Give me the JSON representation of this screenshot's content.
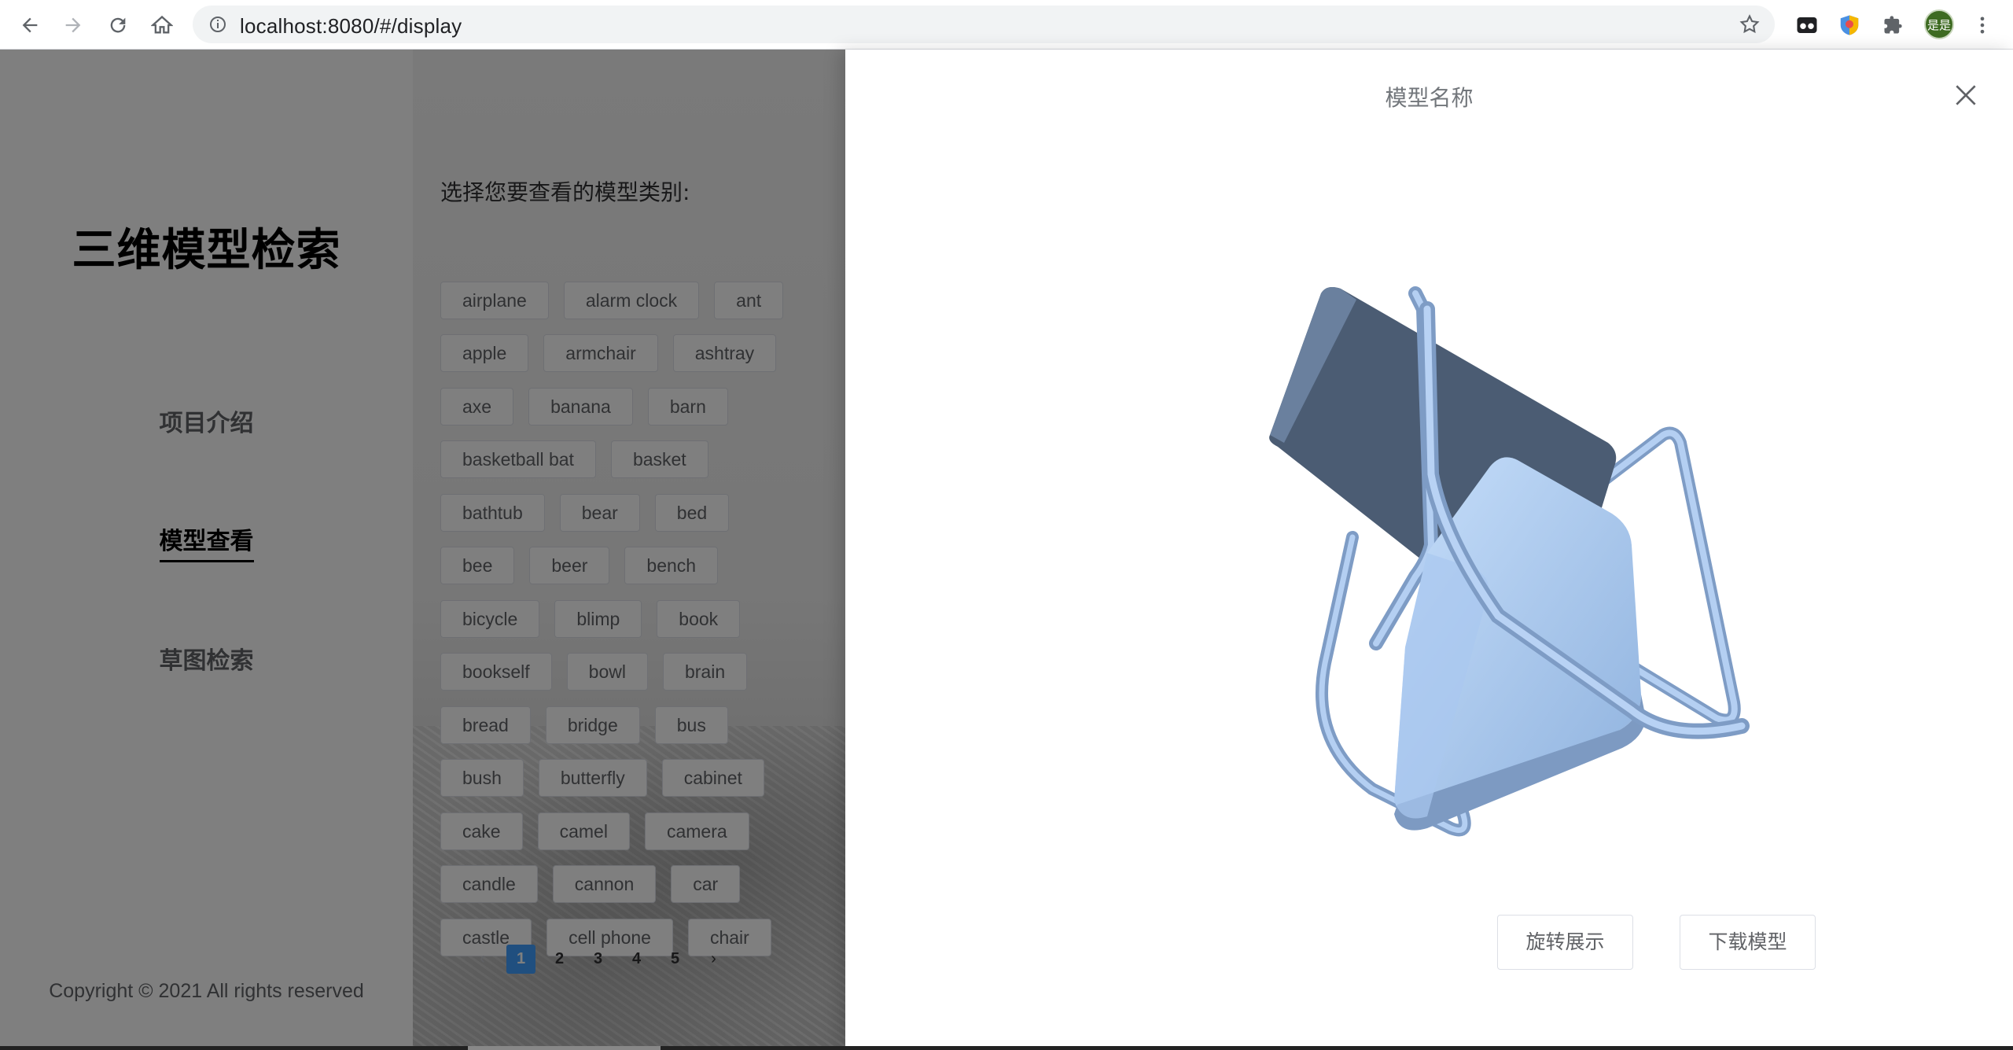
{
  "browser": {
    "url": "localhost:8080/#/display",
    "profile_initials": "是是"
  },
  "sidebar": {
    "brand": "三维模型检索",
    "menu": [
      {
        "label": "项目介绍",
        "active": false
      },
      {
        "label": "模型查看",
        "active": true
      },
      {
        "label": "草图检索",
        "active": false
      }
    ],
    "copyright": "Copyright © 2021 All rights reserved"
  },
  "main": {
    "select_title": "选择您要查看的模型类别:",
    "tag_rows": [
      [
        "airplane",
        "alarm clock",
        "ant"
      ],
      [
        "apple",
        "armchair",
        "ashtray"
      ],
      [
        "axe",
        "banana",
        "barn"
      ],
      [
        "basketball bat",
        "basket"
      ],
      [
        "bathtub",
        "bear",
        "bed"
      ],
      [
        "bee",
        "beer",
        "bench"
      ],
      [
        "bicycle",
        "blimp",
        "book"
      ],
      [
        "bookself",
        "bowl",
        "brain"
      ],
      [
        "bread",
        "bridge",
        "bus"
      ],
      [
        "bush",
        "butterfly",
        "cabinet"
      ],
      [
        "cake",
        "camel",
        "camera"
      ],
      [
        "candle",
        "cannon",
        "car"
      ],
      [
        "castle",
        "cell phone",
        "chair"
      ]
    ],
    "pagination": {
      "pages": [
        "1",
        "2",
        "3",
        "4",
        "5"
      ],
      "current": "1",
      "prev": "‹",
      "next": "›"
    }
  },
  "drawer": {
    "title": "模型名称",
    "rotate_button": "旋转展示",
    "download_button": "下载模型"
  },
  "colors": {
    "accent": "#409eff",
    "model_light": "#a9c8ef",
    "model_dark": "#4a5a70"
  }
}
